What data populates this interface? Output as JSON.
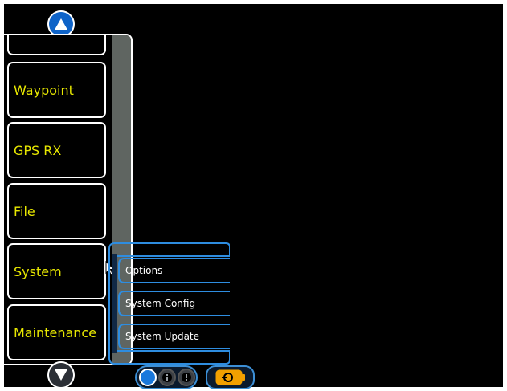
{
  "menu": {
    "items": [
      {
        "label": ""
      },
      {
        "label": "Waypoint"
      },
      {
        "label": "GPS RX"
      },
      {
        "label": "File"
      },
      {
        "label": "System"
      },
      {
        "label": "Maintenance"
      }
    ]
  },
  "submenu": {
    "items": [
      {
        "label": "Options"
      },
      {
        "label": "System Config"
      },
      {
        "label": "System Update"
      }
    ]
  },
  "colors": {
    "background": "#000000",
    "menu_text": "#e8e800",
    "accent_blue": "#1a78dc",
    "battery_orange": "#f2a000",
    "scrollbar": "#5f6561"
  },
  "icons": {
    "scroll_up": "triangle-up-icon",
    "scroll_down": "triangle-down-icon",
    "status_info": "info-icon",
    "status_alert": "alert-icon",
    "battery": "battery-icon",
    "pointer": "mouse-pointer-icon"
  }
}
